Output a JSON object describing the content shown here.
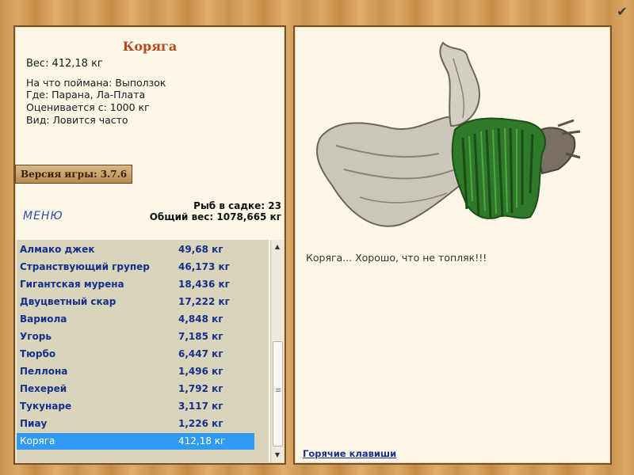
{
  "fish_info": {
    "name": "Коряга",
    "weight_label": "Вес:",
    "weight_value": "412,18 кг",
    "caught_on": "На что поймана: Выползок",
    "location": "Где: Парана, Ла-Плата",
    "valued_from": "Оценивается с: 1000 кг",
    "frequency": "Вид: Ловится часто"
  },
  "game": {
    "version": "Версия игры: 3.7.6",
    "menu": "МЕНЮ"
  },
  "cage": {
    "count": "Рыб в садке: 23",
    "total_weight": "Общий вес: 1078,665 кг"
  },
  "fish_list": [
    {
      "name": "Алмако джек",
      "weight": "49,68 кг"
    },
    {
      "name": "Странствующий групер",
      "weight": "46,173 кг"
    },
    {
      "name": "Гигантская мурена",
      "weight": "18,436 кг"
    },
    {
      "name": "Двуцветный скар",
      "weight": "17,222 кг"
    },
    {
      "name": "Вариола",
      "weight": "4,848 кг"
    },
    {
      "name": "Угорь",
      "weight": "7,185 кг"
    },
    {
      "name": "Тюрбо",
      "weight": "6,447 кг"
    },
    {
      "name": "Пеллона",
      "weight": "1,496 кг"
    },
    {
      "name": "Пехерей",
      "weight": "1,792 кг"
    },
    {
      "name": "Тукунаре",
      "weight": "3,117 кг"
    },
    {
      "name": "Пиау",
      "weight": "1,226 кг"
    },
    {
      "name": "Коряга",
      "weight": "412,18 кг",
      "selected": true
    }
  ],
  "description": "Коряга... Хорошо, что не топляк!!!",
  "hotkeys": "Горячие клавиши",
  "colors": {
    "title": "#b54a1c",
    "list_text": "#152f8c",
    "selected_row": "#2f9bf2",
    "panel_bg": "#fdf7e8"
  },
  "icons": {
    "corner": "checkmark-pin-icon",
    "scroll_up": "arrow-up-icon",
    "scroll_down": "arrow-down-icon"
  }
}
